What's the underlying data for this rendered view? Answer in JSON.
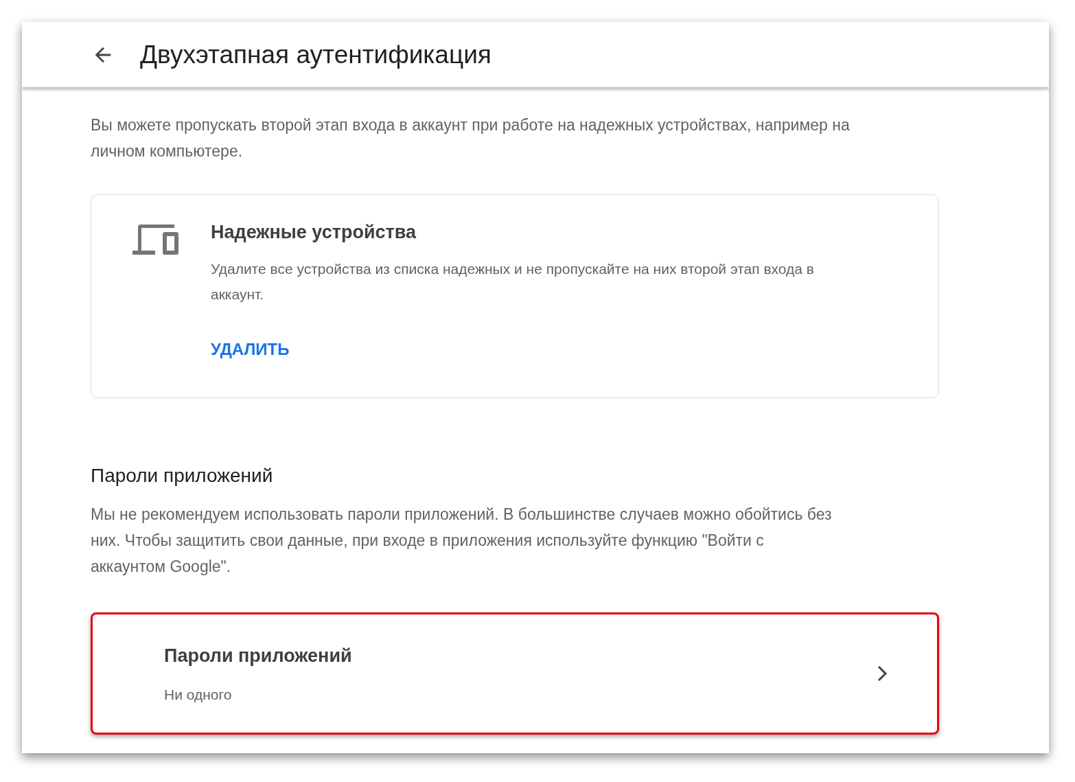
{
  "header": {
    "title": "Двухэтапная аутентификация"
  },
  "trusted_section": {
    "description": "Вы можете пропускать второй этап входа в аккаунт при работе на надежных устройствах, например на личном компьютере.",
    "card": {
      "title": "Надежные устройства",
      "description": "Удалите все устройства из списка надежных и не пропускайте на них второй этап входа в аккаунт.",
      "action": "УДАЛИТЬ"
    }
  },
  "app_passwords_section": {
    "heading": "Пароли приложений",
    "description": "Мы не рекомендуем использовать пароли приложений. В большинстве случаев можно обойтись без них. Чтобы защитить свои данные, при входе в приложения используйте функцию \"Войти с аккаунтом Google\".",
    "item": {
      "title": "Пароли приложений",
      "subtitle": "Ни одного",
      "highlighted": true
    }
  }
}
